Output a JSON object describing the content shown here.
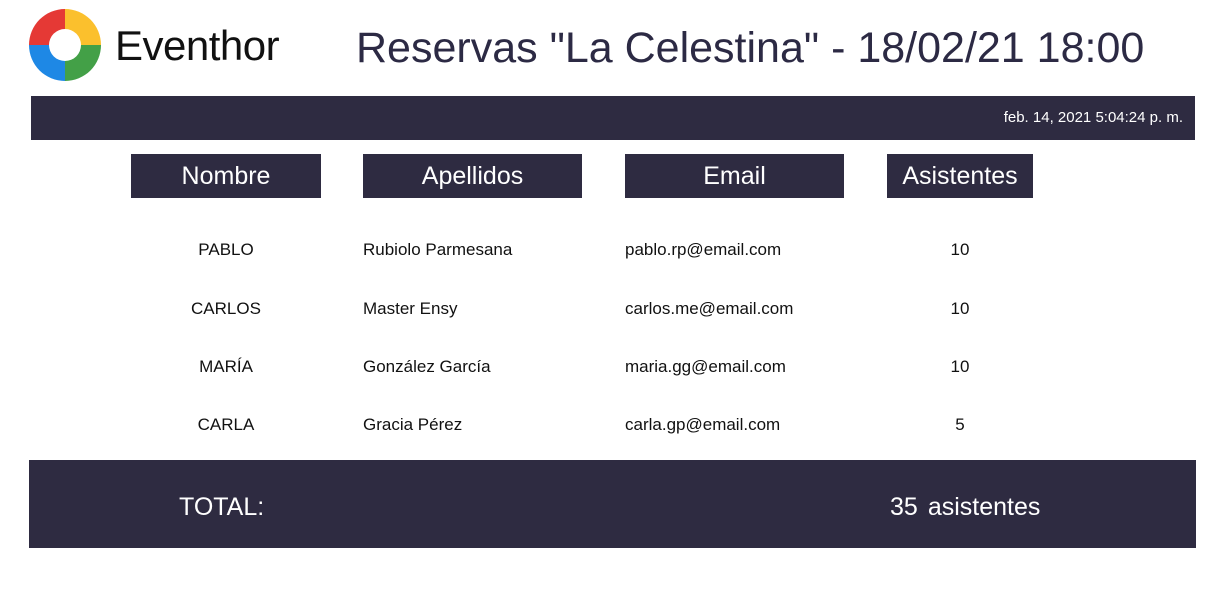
{
  "brand": {
    "name": "Eventhor",
    "logo_colors": [
      "#e53935",
      "#fbc02d",
      "#43a047",
      "#1e88e5"
    ]
  },
  "report": {
    "title": "Reservas \"La Celestina\" - 18/02/21 18:00",
    "generated_at": "feb. 14, 2021 5:04:24 p. m."
  },
  "table": {
    "columns": [
      "Nombre",
      "Apellidos",
      "Email",
      "Asistentes"
    ],
    "rows": [
      {
        "nombre": "PABLO",
        "apellidos": "Rubiolo Parmesana",
        "email": "pablo.rp@email.com",
        "asistentes": "10"
      },
      {
        "nombre": "CARLOS",
        "apellidos": "Master Ensy",
        "email": "carlos.me@email.com",
        "asistentes": "10"
      },
      {
        "nombre": "MARÍA",
        "apellidos": "González García",
        "email": "maria.gg@email.com",
        "asistentes": "10"
      },
      {
        "nombre": "CARLA",
        "apellidos": "Gracia Pérez",
        "email": "carla.gp@email.com",
        "asistentes": "5"
      }
    ]
  },
  "total": {
    "label": "TOTAL:",
    "count": "35",
    "unit": "asistentes"
  },
  "colors": {
    "bar": "#2e2b41",
    "title": "#2c2a44"
  }
}
